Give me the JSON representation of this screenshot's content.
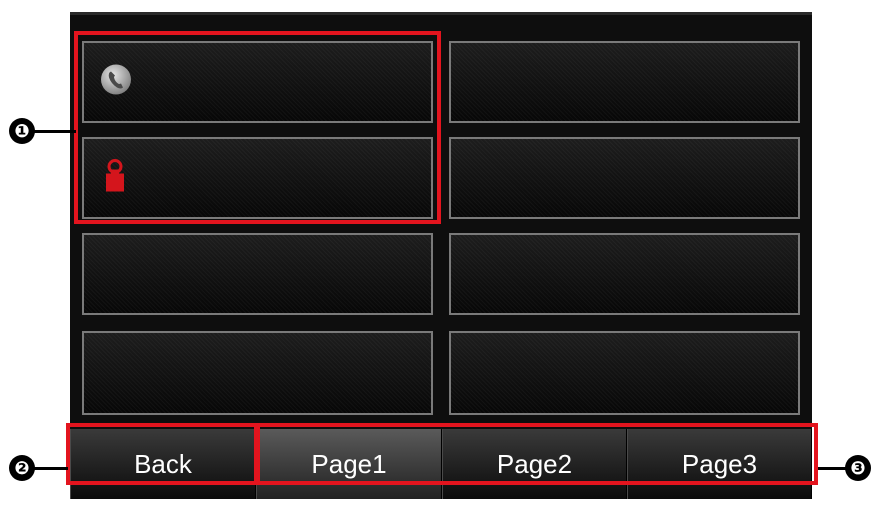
{
  "grid": {
    "buttons": [
      {
        "icon": "phone-icon",
        "label": ""
      },
      {
        "icon": "",
        "label": ""
      },
      {
        "icon": "lock-icon",
        "label": ""
      },
      {
        "icon": "",
        "label": ""
      },
      {
        "icon": "",
        "label": ""
      },
      {
        "icon": "",
        "label": ""
      },
      {
        "icon": "",
        "label": ""
      },
      {
        "icon": "",
        "label": ""
      }
    ]
  },
  "nav": {
    "back_label": "Back",
    "pages": [
      "Page1",
      "Page2",
      "Page3"
    ],
    "active_page": "Page1"
  },
  "callouts": {
    "one": "❶",
    "two": "❷",
    "three": "❸"
  },
  "colors": {
    "highlight": "#e3141e",
    "background": "#0e0e0e",
    "button_border": "#7a7a7a",
    "text": "#ffffff"
  }
}
